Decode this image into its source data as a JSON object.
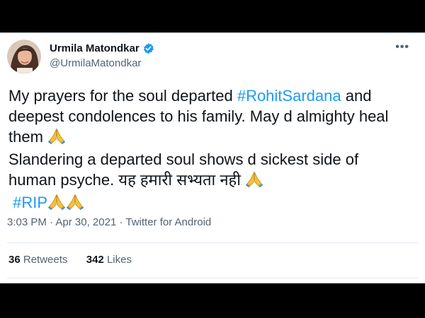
{
  "colors": {
    "link": "#1d9bf0",
    "verified": "#1d9bf0",
    "text": "#0f1419",
    "muted": "#536471"
  },
  "author": {
    "display_name": "Urmila Matondkar",
    "handle": "@UrmilaMatondkar",
    "avatar_icon": "profile-photo",
    "verified_icon": "verified-badge-icon"
  },
  "more_label": "•••",
  "tweet": {
    "l1_text": "My prayers for the soul departed ",
    "l1_tag": "#RohitSardana",
    "l1_after": " and",
    "l2_text": "deepest condolences to his family. May d almighty heal",
    "l3_text": "them ",
    "l4_text": "Slandering a departed soul shows d sickest side of",
    "l5_text": "human psyche. यह हमारी सभ्यता नही ",
    "l6_tag": "#RIP",
    "emoji_icon": "folded-hands-icon"
  },
  "meta": {
    "time": "3:03 PM",
    "dot1": " · ",
    "date": "Apr 30, 2021",
    "dot2": " · ",
    "source": "Twitter for Android"
  },
  "stats": {
    "retweets_count": "36",
    "retweets_label": "Retweets",
    "likes_count": "342",
    "likes_label": "Likes"
  }
}
